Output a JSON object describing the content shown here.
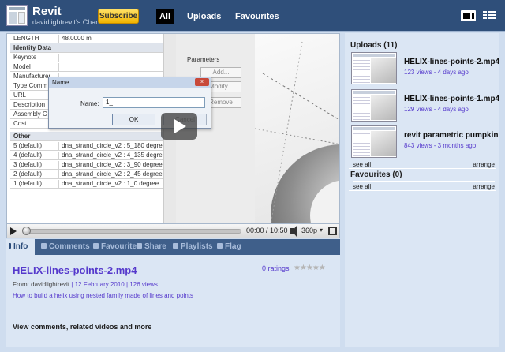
{
  "header": {
    "channel_name": "Revit",
    "channel_subtitle": "davidlightrevit's Channel",
    "subscribe_label": "Subscribe",
    "tabs": [
      {
        "label": "All",
        "active": true
      },
      {
        "label": "Uploads",
        "active": false
      },
      {
        "label": "Favourites",
        "active": false
      }
    ],
    "view_icons": [
      "player-view-icon",
      "grid-view-icon"
    ]
  },
  "video_frame": {
    "properties": [
      {
        "key": "LENGTH",
        "value": "48.0000 m",
        "header": false
      },
      {
        "key": "Identity Data",
        "value": "",
        "header": true
      },
      {
        "key": "Keynote",
        "value": "",
        "header": false
      },
      {
        "key": "Model",
        "value": "",
        "header": false
      },
      {
        "key": "Manufacturer",
        "value": "",
        "header": false
      },
      {
        "key": "Type Comm",
        "value": "",
        "header": false
      },
      {
        "key": "URL",
        "value": "",
        "header": false
      },
      {
        "key": "Description",
        "value": "",
        "header": false
      },
      {
        "key": "Assembly C",
        "value": "",
        "header": false
      },
      {
        "key": "Cost",
        "value": "",
        "header": false
      },
      {
        "key": "Other",
        "value": "",
        "header": true
      },
      {
        "key": "5 (default)",
        "value": "dna_strand_circle_v2 : 5_180 degree",
        "header": false
      },
      {
        "key": "4 (default)",
        "value": "dna_strand_circle_v2 : 4_135 degree",
        "header": false
      },
      {
        "key": "3 (default)",
        "value": "dna_strand_circle_v2 : 3_90 degree",
        "header": false
      },
      {
        "key": "2 (default)",
        "value": "dna_strand_circle_v2 : 2_45 degree",
        "header": false
      },
      {
        "key": "1 (default)",
        "value": "dna_strand_circle_v2 : 1_0 degree",
        "header": false
      }
    ],
    "parameters_label": "Parameters",
    "param_buttons": [
      "Add...",
      "Modify...",
      "Remove"
    ],
    "dialog": {
      "title": "Name",
      "close_label": "x",
      "name_label": "Name:",
      "name_value": "1_",
      "ok_label": "OK",
      "cancel_label": "Cancel"
    }
  },
  "player_controls": {
    "time": "00:00 / 10:50",
    "quality": "360p",
    "quality_arrow": "▾",
    "progress": 0
  },
  "info_tabs": [
    "Info",
    "Comments",
    "Favourite",
    "Share",
    "Playlists",
    "Flag"
  ],
  "info": {
    "title": "HELIX-lines-points-2.mp4",
    "ratings": "0 ratings",
    "stars": "★★★★★",
    "from_label": "From:",
    "user": "davidlightrevit",
    "separator_1": "|",
    "date": "12 February 2010",
    "separator_2": "|",
    "views": "126 views",
    "description": "How to build a helix using nested family made of lines and points",
    "more_link": "View comments, related videos and more"
  },
  "sidebar": {
    "uploads_title": "Uploads (11)",
    "uploads": [
      {
        "title": "HELIX-lines-points-2.mp4",
        "meta": "123 views - 4 days ago"
      },
      {
        "title": "HELIX-lines-points-1.mp4",
        "meta": "129 views - 4 days ago"
      },
      {
        "title": "revit parametric pumpkin",
        "meta": "843 views - 3 months ago"
      }
    ],
    "see_all": "see all",
    "arrange": "arrange",
    "favourites_title": "Favourites (0)",
    "fav_see_all": "see all",
    "fav_arrange": "arrange"
  },
  "colors": {
    "header_bg": "#2f4f7a",
    "page_bg": "#cfddef",
    "panel_bg": "#dbe6f4",
    "link": "#5539cc",
    "subscribe": "#f1b400"
  }
}
